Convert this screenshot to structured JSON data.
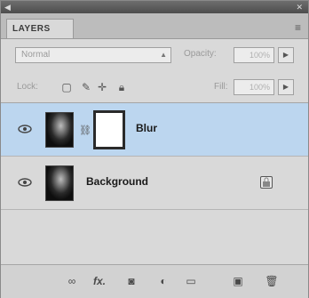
{
  "panel": {
    "tab_label": "LAYERS",
    "menu_icon": "panel-menu-icon"
  },
  "blend": {
    "mode": "Normal",
    "opacity_label": "Opacity:",
    "opacity_value": "100%"
  },
  "lock": {
    "label": "Lock:",
    "fill_label": "Fill:",
    "fill_value": "100%"
  },
  "layers": [
    {
      "name": "Blur",
      "selected": true,
      "has_mask": true
    },
    {
      "name": "Background",
      "selected": false,
      "locked": true
    }
  ],
  "footer": {
    "link_label": "∞",
    "fx_label": "fx."
  },
  "colors": {
    "selection": "#bcd6ef",
    "panel_bg": "#d9d9d9",
    "titlebar": "#5a5a5a"
  }
}
